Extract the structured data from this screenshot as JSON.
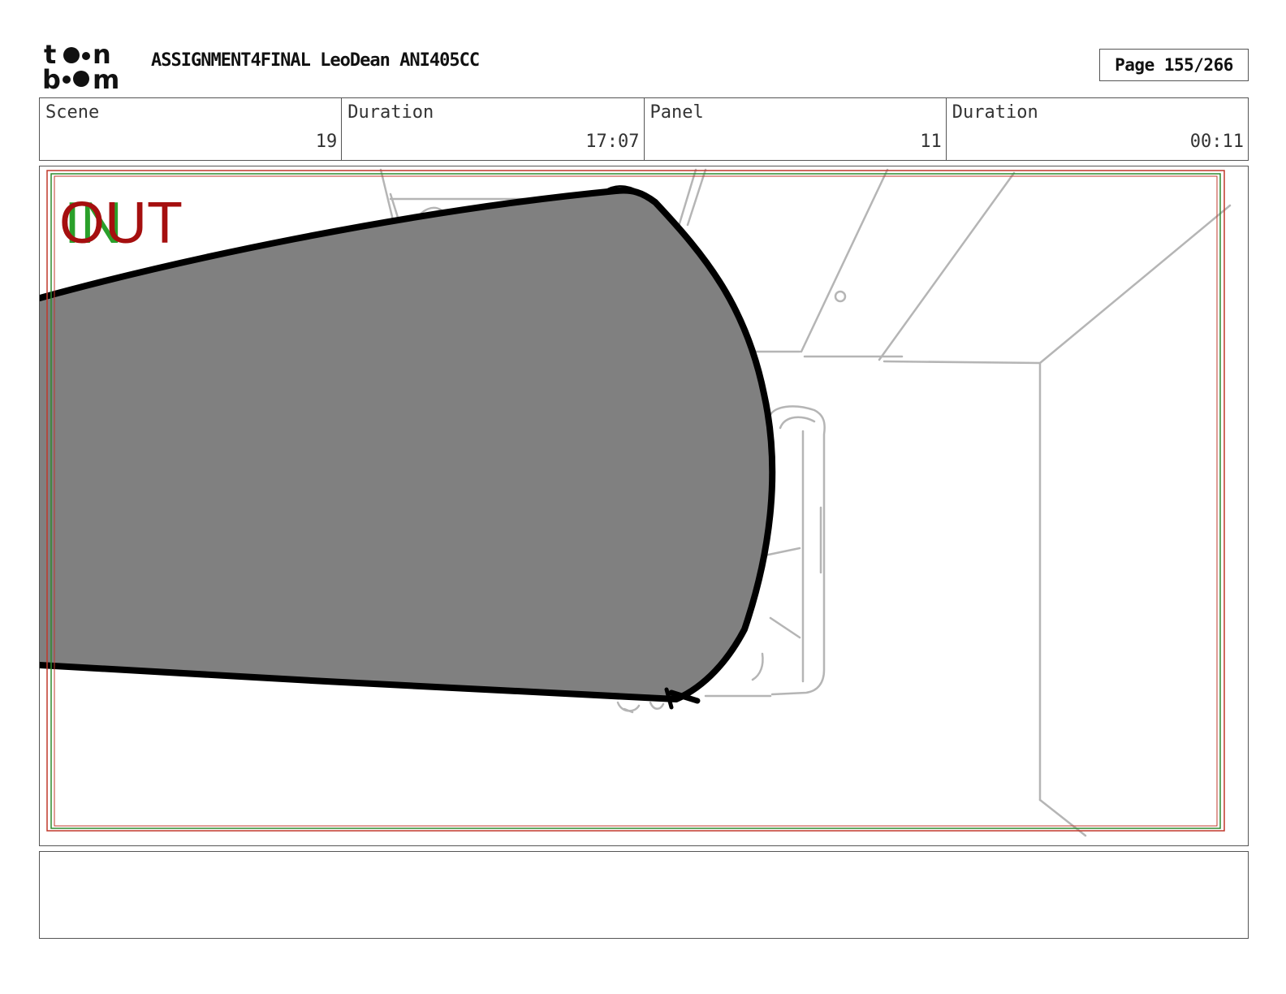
{
  "header": {
    "logo": {
      "top_text": "toon",
      "bottom_text": "boom"
    },
    "project_title": "ASSIGNMENT4FINAL LeoDean ANI405CC",
    "page_label": "Page 155/266"
  },
  "info_bar": [
    {
      "label": "Scene",
      "value": "19"
    },
    {
      "label": "Duration",
      "value": "17:07"
    },
    {
      "label": "Panel",
      "value": "11"
    },
    {
      "label": "Duration",
      "value": "00:11"
    }
  ],
  "panel": {
    "in_marker": "IN",
    "out_marker": "OUT",
    "colors": {
      "in_marker": "#2aa02a",
      "out_marker": "#a50f0f",
      "safe_frame_red": "#c0392b",
      "safe_frame_green": "#2e8b2e",
      "shape_fill": "#808080",
      "outline": "#000000",
      "sketch_lines": "#b5b5b5"
    }
  },
  "caption": {
    "text": ""
  }
}
